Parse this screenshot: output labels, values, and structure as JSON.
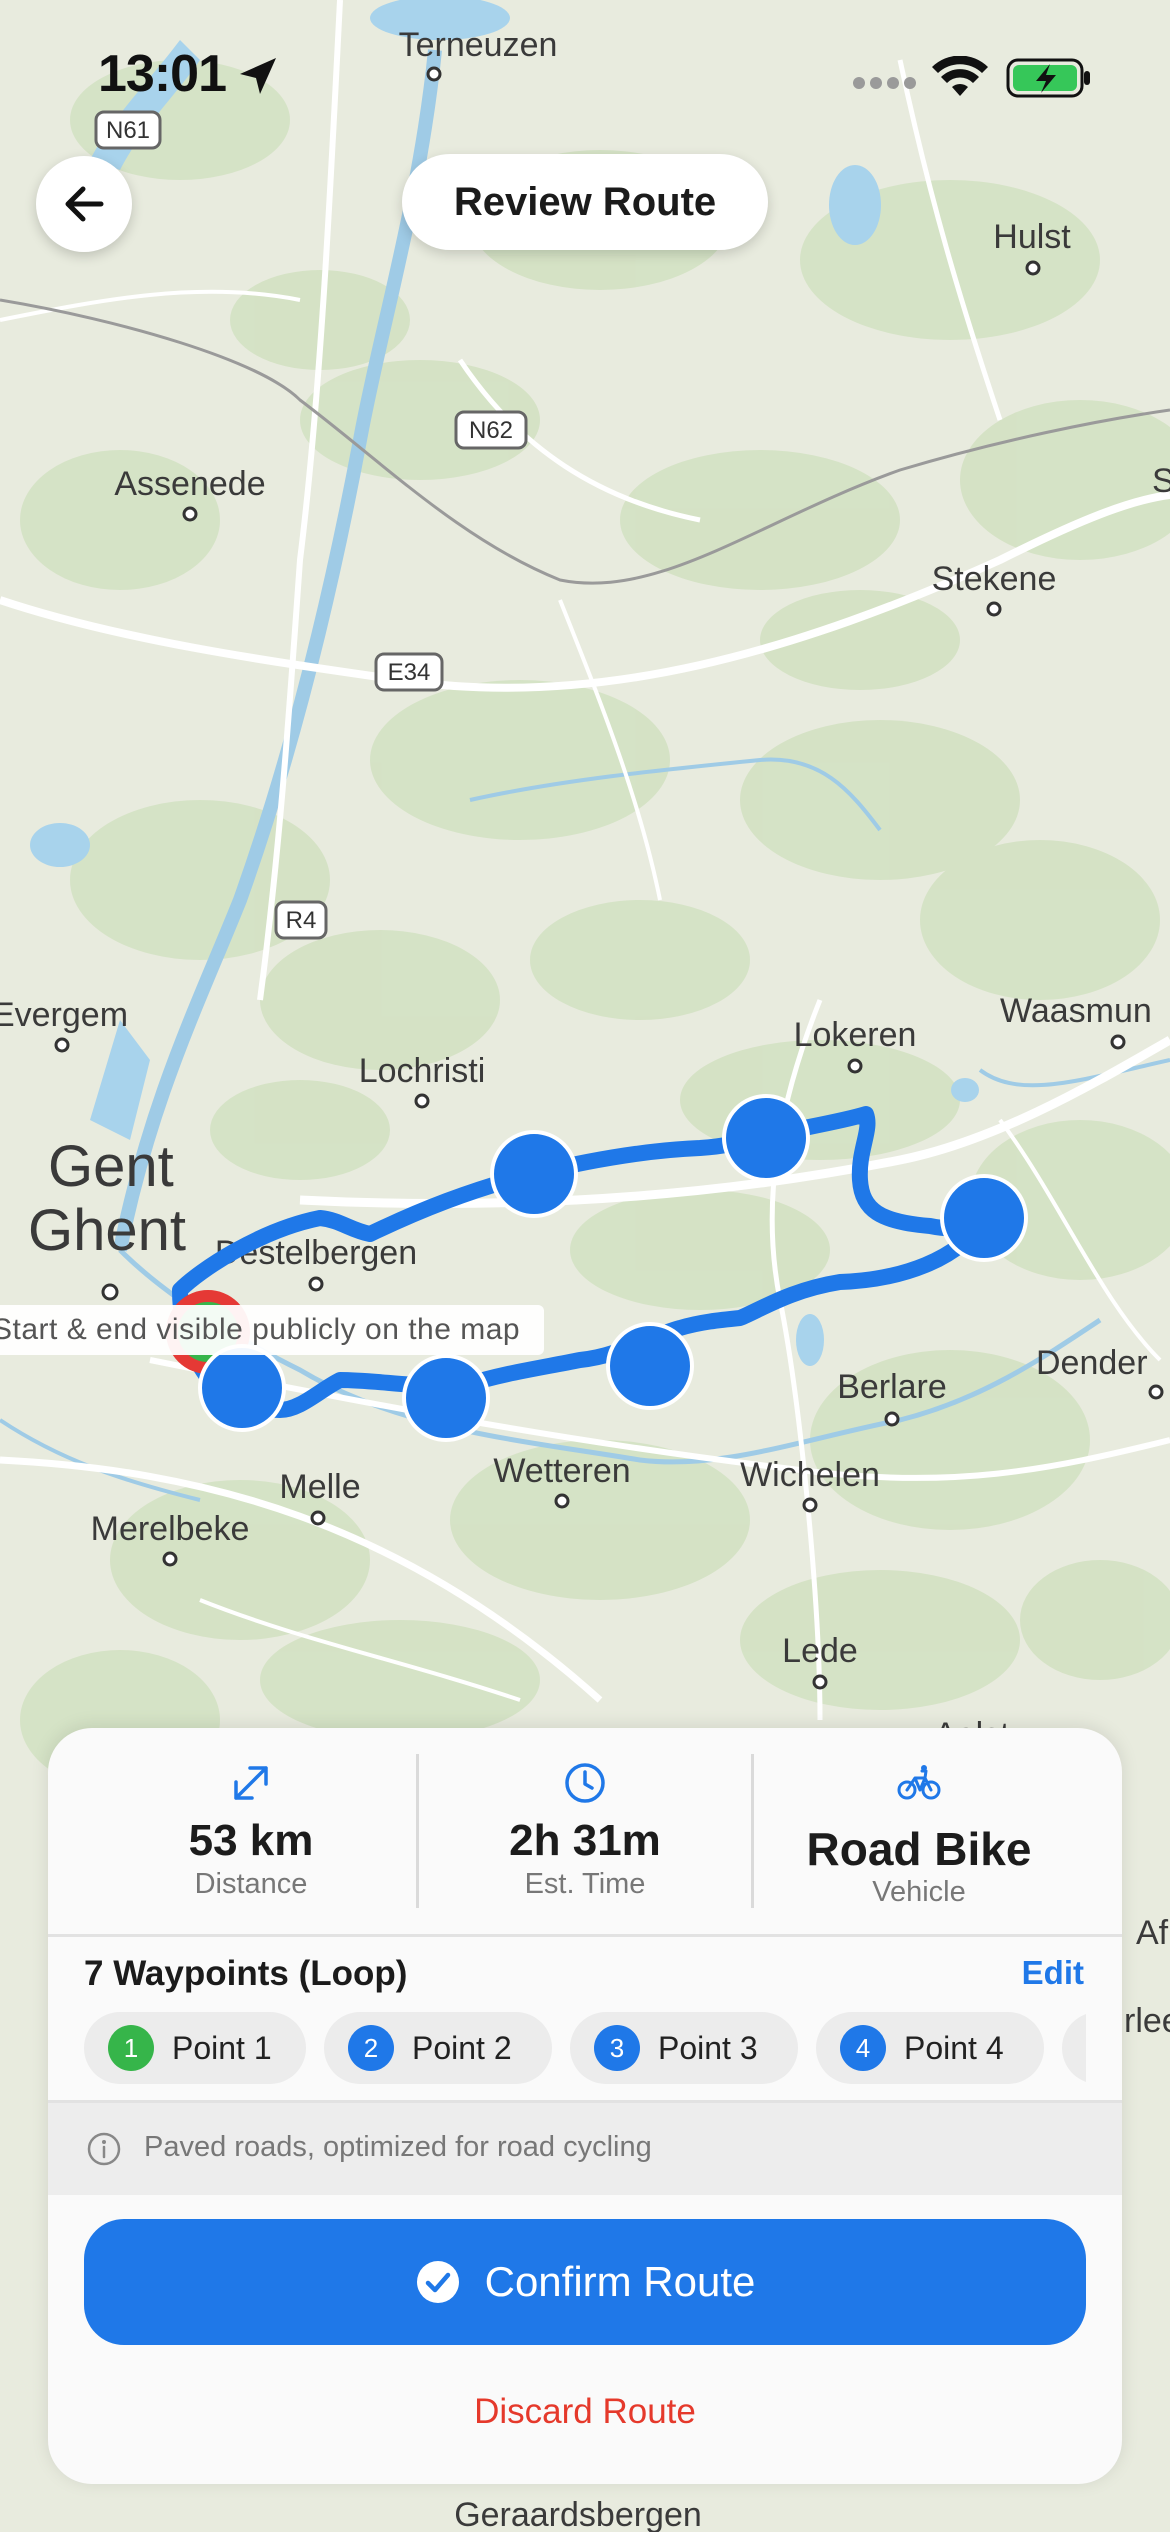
{
  "status_bar": {
    "time": "13:01"
  },
  "header": {
    "title": "Review Route"
  },
  "map": {
    "places": {
      "terneuzen": "Terneuzen",
      "hulst": "Hulst",
      "assenede": "Assenede",
      "stekene": "Stekene",
      "evergem": "Evergem",
      "lochristi": "Lochristi",
      "lokeren": "Lokeren",
      "waasmunster": "Waasmun",
      "gent": "Gent",
      "ghent": "Ghent",
      "destelbergen": "Destelbergen",
      "dendermonde": "Dender",
      "berlare": "Berlare",
      "melle": "Melle",
      "wetteren": "Wetteren",
      "wichelen": "Wichelen",
      "merelbeke": "Merelbeke",
      "lede": "Lede",
      "aalst": "Aalst",
      "geraardsbergen": "Geraardsbergen",
      "ninove_partial": "Af",
      "erpe_partial": "rlee",
      "s_partial": "S"
    },
    "road_labels": {
      "n61": "N61",
      "n62": "N62",
      "e34": "E34",
      "r4": "R4"
    },
    "privacy_label": "Start & end visible publicly on the map"
  },
  "summary": {
    "distance": {
      "value": "53 km",
      "label": "Distance",
      "icon": "expand-arrows-icon"
    },
    "time": {
      "value": "2h 31m",
      "label": "Est. Time",
      "icon": "clock-icon"
    },
    "vehicle": {
      "value": "Road Bike",
      "label": "Vehicle",
      "icon": "bicycle-icon"
    }
  },
  "waypoints": {
    "title": "7 Waypoints (Loop)",
    "edit_label": "Edit",
    "items": [
      {
        "num": "1",
        "label": "Point 1",
        "color": "#36b54a"
      },
      {
        "num": "2",
        "label": "Point 2",
        "color": "#1f78e8"
      },
      {
        "num": "3",
        "label": "Point 3",
        "color": "#1f78e8"
      },
      {
        "num": "4",
        "label": "Point 4",
        "color": "#1f78e8"
      }
    ]
  },
  "note": "Paved roads, optimized for road cycling",
  "actions": {
    "confirm": "Confirm Route",
    "discard": "Discard Route"
  },
  "colors": {
    "accent": "#1f78e8",
    "danger": "#e5392b",
    "start": "#36b54a",
    "start_ring": "#e53935"
  }
}
